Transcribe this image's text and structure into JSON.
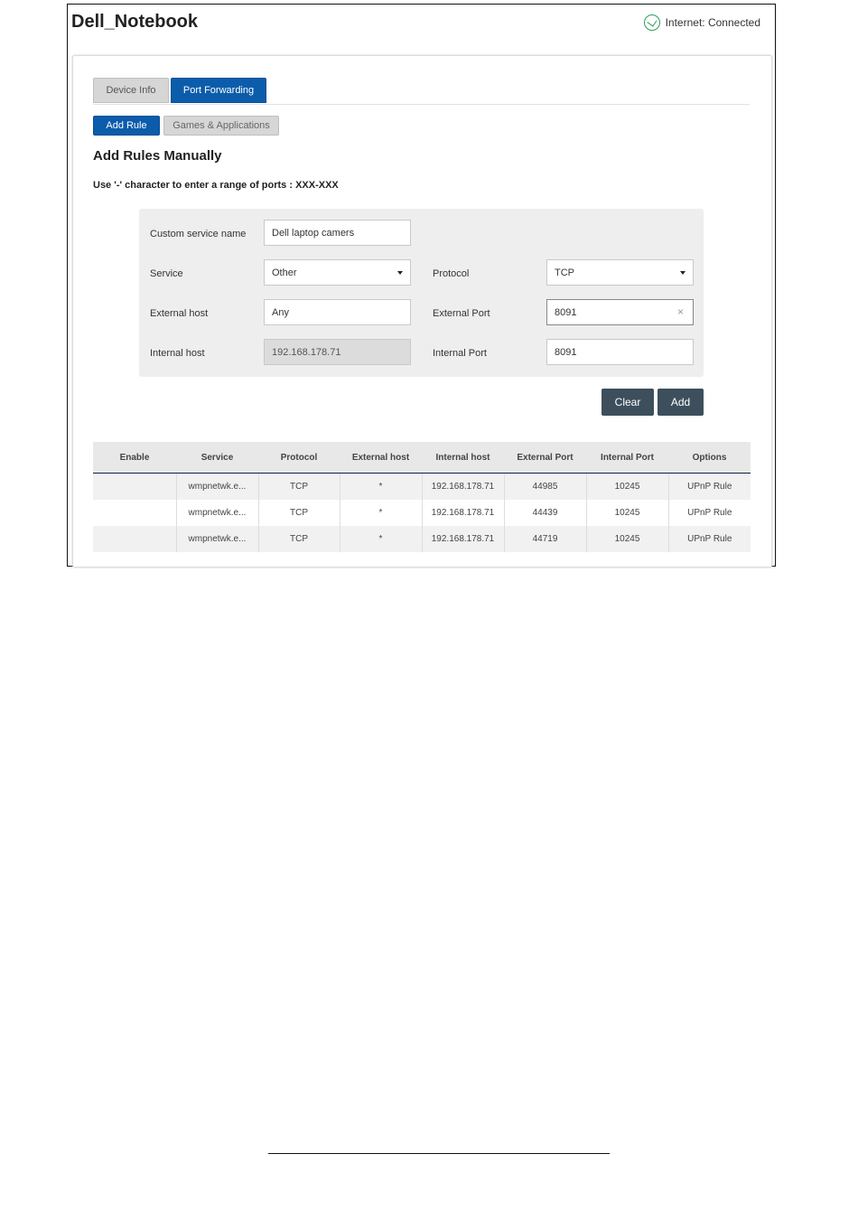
{
  "app": {
    "title": "Dell_Notebook",
    "status_text": "Internet: Connected"
  },
  "tabs": [
    {
      "label": "Device Info",
      "active": false
    },
    {
      "label": "Port Forwarding",
      "active": true
    }
  ],
  "subtabs": [
    {
      "label": "Add Rule",
      "active": true
    },
    {
      "label": "Games & Applications",
      "active": false
    }
  ],
  "section_title": "Add Rules Manually",
  "hint": "Use '-' character to enter a range of ports : XXX-XXX",
  "form": {
    "custom_service_name": {
      "label": "Custom service name",
      "value": "Dell laptop camers"
    },
    "service": {
      "label": "Service",
      "value": "Other"
    },
    "protocol": {
      "label": "Protocol",
      "value": "TCP"
    },
    "external_host": {
      "label": "External host",
      "value": "Any"
    },
    "external_port": {
      "label": "External Port",
      "value": "8091"
    },
    "internal_host": {
      "label": "Internal host",
      "value": "192.168.178.71"
    },
    "internal_port": {
      "label": "Internal Port",
      "value": "8091"
    }
  },
  "buttons": {
    "clear": "Clear",
    "add": "Add"
  },
  "table": {
    "headers": [
      "Enable",
      "Service",
      "Protocol",
      "External host",
      "Internal host",
      "External Port",
      "Internal Port",
      "Options"
    ],
    "rows": [
      [
        "",
        "wmpnetwk.e...",
        "TCP",
        "*",
        "192.168.178.71",
        "44985",
        "10245",
        "UPnP Rule"
      ],
      [
        "",
        "wmpnetwk.e...",
        "TCP",
        "*",
        "192.168.178.71",
        "44439",
        "10245",
        "UPnP Rule"
      ],
      [
        "",
        "wmpnetwk.e...",
        "TCP",
        "*",
        "192.168.178.71",
        "44719",
        "10245",
        "UPnP Rule"
      ]
    ]
  },
  "colors": {
    "accent": "#0b5cab",
    "button_dark": "#3d4f5c",
    "status_green": "#2e9e5a"
  },
  "icons": {
    "status": "connected-globe-icon"
  }
}
